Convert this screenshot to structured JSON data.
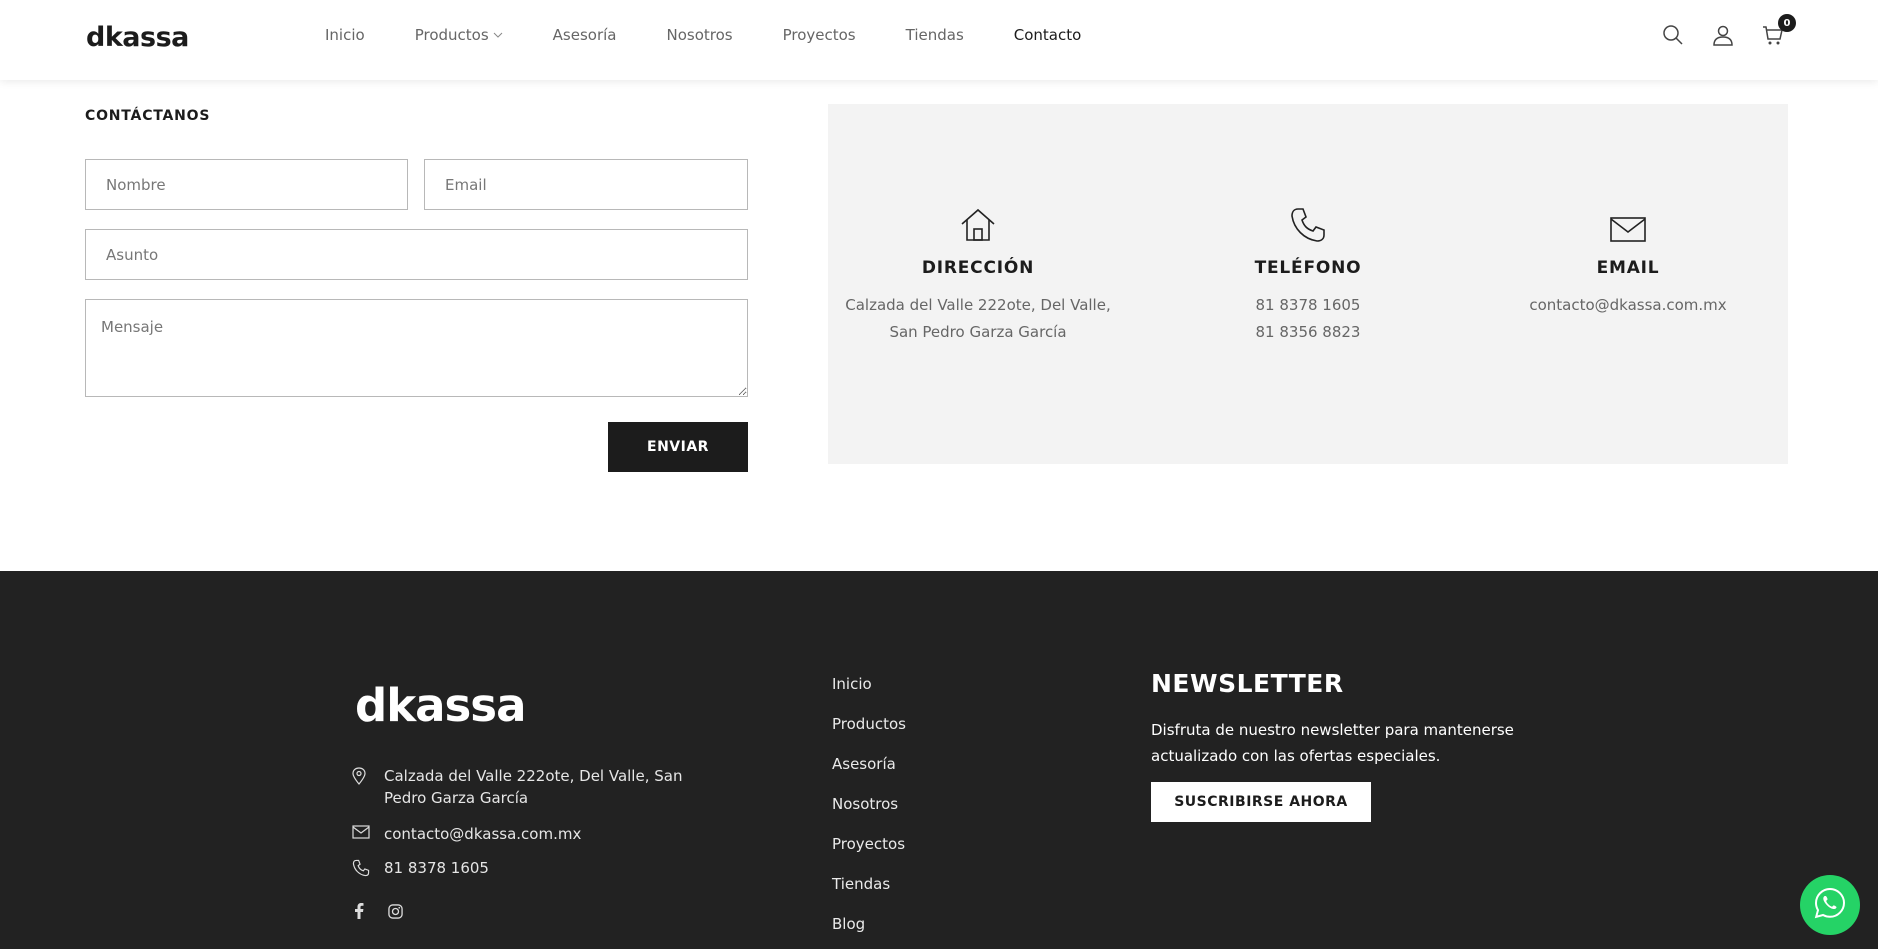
{
  "header": {
    "logo": "dkassa",
    "nav": [
      {
        "label": "Inicio"
      },
      {
        "label": "Productos"
      },
      {
        "label": "Asesoría"
      },
      {
        "label": "Nosotros"
      },
      {
        "label": "Proyectos"
      },
      {
        "label": "Tiendas"
      },
      {
        "label": "Contacto"
      }
    ],
    "cart_count": "0"
  },
  "form": {
    "title": "CONTÁCTANOS",
    "name_placeholder": "Nombre",
    "email_placeholder": "Email",
    "subject_placeholder": "Asunto",
    "message_placeholder": "Mensaje",
    "submit_label": "ENVIAR"
  },
  "info": {
    "address": {
      "title": "DIRECCIÓN",
      "line1": "Calzada del Valle 222ote, Del Valle,",
      "line2": "San Pedro Garza García"
    },
    "phone": {
      "title": "TELÉFONO",
      "line1": "81 8378 1605",
      "line2": "81 8356 8823"
    },
    "email": {
      "title": "EMAIL",
      "line1": "contacto@dkassa.com.mx"
    }
  },
  "footer": {
    "logo": "dkassa",
    "address": "Calzada del Valle 222ote, Del Valle, San Pedro Garza García",
    "email": "contacto@dkassa.com.mx",
    "phone": "81 8378 1605",
    "links": [
      {
        "label": "Inicio"
      },
      {
        "label": "Productos"
      },
      {
        "label": "Asesoría"
      },
      {
        "label": "Nosotros"
      },
      {
        "label": "Proyectos"
      },
      {
        "label": "Tiendas"
      },
      {
        "label": "Blog"
      }
    ],
    "newsletter": {
      "title": "NEWSLETTER",
      "text": "Disfruta de nuestro newsletter para mantenerse actualizado con las ofertas especiales.",
      "button": "SUSCRIBIRSE AHORA"
    }
  },
  "colors": {
    "dark": "#222222",
    "accent_whatsapp": "#25d366",
    "info_bg": "#f3f3f3"
  }
}
